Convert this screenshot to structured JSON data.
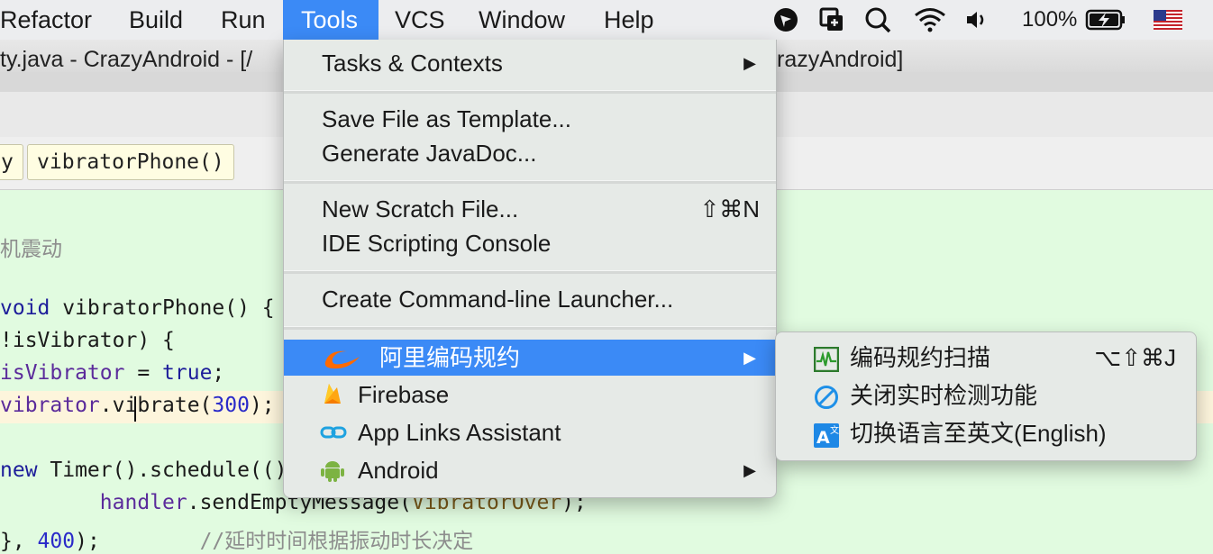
{
  "menubar": {
    "items": [
      "Refactor",
      "Build",
      "Run",
      "Tools",
      "VCS",
      "Window",
      "Help"
    ],
    "active": "Tools",
    "battery": "100%"
  },
  "window": {
    "title_left": "ty.java - CrazyAndroid - [/",
    "title_right": "razyAndroid]"
  },
  "breadcrumbs": [
    "y",
    "vibratorPhone()"
  ],
  "editor": {
    "lines": [
      {
        "segments": [
          {
            "t": "机震动",
            "c": "cmt"
          }
        ]
      },
      {
        "segments": [
          {
            "t": "void",
            "c": "kw"
          },
          {
            "t": " vibratorPhone() {",
            "c": ""
          }
        ]
      },
      {
        "segments": [
          {
            "t": "!isVibrator) {",
            "c": ""
          }
        ]
      },
      {
        "segments": [
          {
            "t": "isVibrator",
            "c": "field"
          },
          {
            "t": " = ",
            "c": ""
          },
          {
            "t": "true",
            "c": "kw"
          },
          {
            "t": ";",
            "c": ""
          }
        ]
      },
      {
        "segments": [
          {
            "t": "vibrator",
            "c": "field"
          },
          {
            "t": ".vibrate(",
            "c": ""
          },
          {
            "t": "300",
            "c": "num"
          },
          {
            "t": ");",
            "c": ""
          }
        ]
      },
      {
        "segments": [
          {
            "t": "new",
            "c": "kw"
          },
          {
            "t": " Timer().schedule(()",
            "c": ""
          }
        ]
      },
      {
        "segments": [
          {
            "t": "        handler",
            "c": "field"
          },
          {
            "t": ".sendEmptyMessage(",
            "c": ""
          },
          {
            "t": "VibratorOver",
            "c": "const"
          },
          {
            "t": ");",
            "c": ""
          }
        ]
      },
      {
        "segments": [
          {
            "t": "}, ",
            "c": ""
          },
          {
            "t": "400",
            "c": "num"
          },
          {
            "t": ");        ",
            "c": ""
          },
          {
            "t": "//延时时间根据振动时长决定",
            "c": "cmt"
          }
        ]
      }
    ]
  },
  "tools_menu": {
    "items": [
      {
        "label": "Tasks & Contexts",
        "arrow": "▶"
      },
      {
        "label": "Save File as Template..."
      },
      {
        "label": "Generate JavaDoc..."
      },
      {
        "label": "New Scratch File...",
        "shortcut": "⇧⌘N"
      },
      {
        "label": "IDE Scripting Console"
      },
      {
        "label": "Create Command-line Launcher..."
      },
      {
        "label": "阿里编码规约",
        "arrow": "▶",
        "icon": "alibaba-logo-icon"
      },
      {
        "label": "Firebase",
        "icon": "firebase-flame-icon"
      },
      {
        "label": "App Links Assistant",
        "icon": "link-chain-icon"
      },
      {
        "label": "Android",
        "arrow": "▶",
        "icon": "android-robot-icon"
      }
    ]
  },
  "submenu": {
    "items": [
      {
        "label": "编码规约扫描",
        "shortcut": "⌥⇧⌘J",
        "icon": "scan-chart-icon"
      },
      {
        "label": "关闭实时检测功能",
        "icon": "no-entry-icon"
      },
      {
        "label": "切换语言至英文(English)",
        "icon": "language-switch-icon"
      }
    ]
  },
  "colors": {
    "accent": "#3b8af6",
    "editor_bg": "#e1fbe0"
  }
}
